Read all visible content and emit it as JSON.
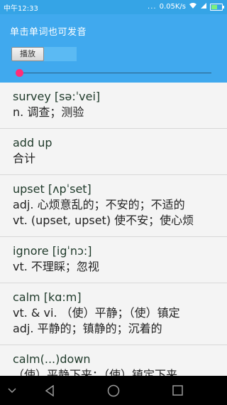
{
  "status_bar": {
    "time": "中午12:33",
    "dots": "...",
    "speed": "0.05K/s",
    "battery_level": 0.6
  },
  "header": {
    "title": "单击单词也可发音",
    "play_label": "播放",
    "slider_value": 0.0
  },
  "words": [
    {
      "word": "survey [sə:ˈvei]",
      "meanings": [
        "n. 调查；测验"
      ]
    },
    {
      "word": "add up",
      "meanings": [
        "合计"
      ]
    },
    {
      "word": "upset [ʌpˈset]",
      "meanings": [
        "adj. 心烦意乱的；不安的；不适的",
        "vt. (upset, upset) 使不安；使心烦"
      ]
    },
    {
      "word": "ignore [igˈnɔ:]",
      "meanings": [
        "vt. 不理睬；忽视"
      ]
    },
    {
      "word": "calm [kɑ:m]",
      "meanings": [
        "vt. & vi. （使）平静；（使）镇定",
        "adj. 平静的；镇静的；沉着的"
      ]
    },
    {
      "word": "calm(...)down",
      "meanings": [
        "（使）平静下来；（使）镇定下来"
      ]
    }
  ],
  "nav": {
    "icons": [
      "chevron-down-icon",
      "back-icon",
      "home-icon",
      "recents-icon"
    ]
  }
}
